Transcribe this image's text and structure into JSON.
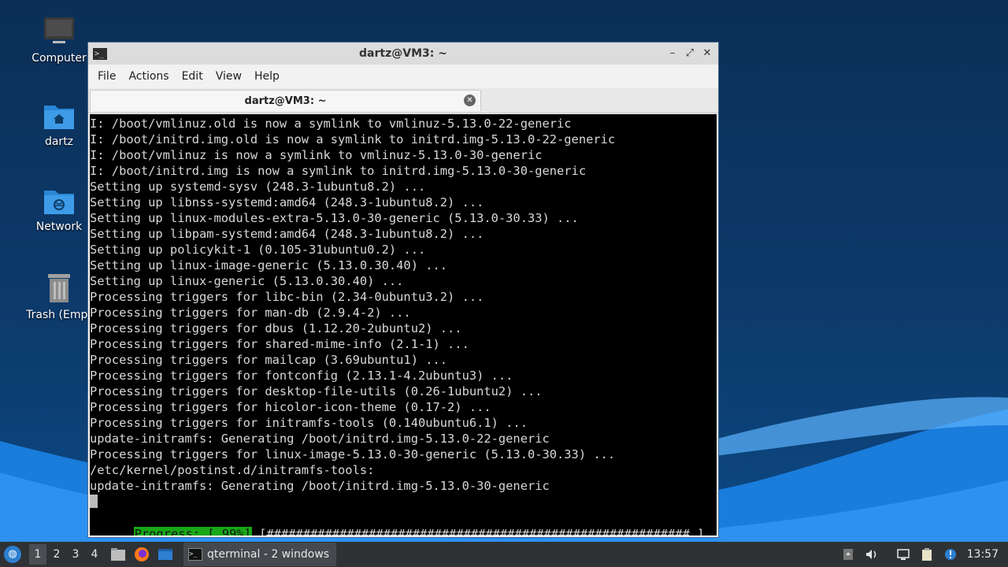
{
  "desktop": {
    "icons": [
      {
        "label": "Computer"
      },
      {
        "label": "dartz"
      },
      {
        "label": "Network"
      },
      {
        "label": "Trash (Empt"
      }
    ]
  },
  "window": {
    "title": "dartz@VM3: ~",
    "icon_text": ">_",
    "buttons": {
      "minimize": "–",
      "maximize": "⤢",
      "close": "✕"
    },
    "menu": [
      "File",
      "Actions",
      "Edit",
      "View",
      "Help"
    ],
    "tab": {
      "label": "dartz@VM3: ~",
      "close": "✕"
    }
  },
  "terminal": {
    "lines": [
      "I: /boot/vmlinuz.old is now a symlink to vmlinuz-5.13.0-22-generic",
      "I: /boot/initrd.img.old is now a symlink to initrd.img-5.13.0-22-generic",
      "I: /boot/vmlinuz is now a symlink to vmlinuz-5.13.0-30-generic",
      "I: /boot/initrd.img is now a symlink to initrd.img-5.13.0-30-generic",
      "Setting up systemd-sysv (248.3-1ubuntu8.2) ...",
      "Setting up libnss-systemd:amd64 (248.3-1ubuntu8.2) ...",
      "Setting up linux-modules-extra-5.13.0-30-generic (5.13.0-30.33) ...",
      "Setting up libpam-systemd:amd64 (248.3-1ubuntu8.2) ...",
      "Setting up policykit-1 (0.105-31ubuntu0.2) ...",
      "Setting up linux-image-generic (5.13.0.30.40) ...",
      "Setting up linux-generic (5.13.0.30.40) ...",
      "Processing triggers for libc-bin (2.34-0ubuntu3.2) ...",
      "Processing triggers for man-db (2.9.4-2) ...",
      "Processing triggers for dbus (1.12.20-2ubuntu2) ...",
      "Processing triggers for shared-mime-info (2.1-1) ...",
      "Processing triggers for mailcap (3.69ubuntu1) ...",
      "Processing triggers for fontconfig (2.13.1-4.2ubuntu3) ...",
      "Processing triggers for desktop-file-utils (0.26-1ubuntu2) ...",
      "Processing triggers for hicolor-icon-theme (0.17-2) ...",
      "Processing triggers for initramfs-tools (0.140ubuntu6.1) ...",
      "update-initramfs: Generating /boot/initrd.img-5.13.0-22-generic",
      "Processing triggers for linux-image-5.13.0-30-generic (5.13.0-30.33) ...",
      "/etc/kernel/postinst.d/initramfs-tools:",
      "update-initramfs: Generating /boot/initrd.img-5.13.0-30-generic"
    ],
    "progress_label": "Progress: [ 99%]",
    "progress_bar": " [##########################################################.]",
    "progress_percent": 99
  },
  "taskbar": {
    "start_icon": "start-menu-icon",
    "workspaces": [
      "1",
      "2",
      "3",
      "4"
    ],
    "active_workspace": "1",
    "task_label": "qterminal - 2 windows",
    "clock": "13:57"
  },
  "colors": {
    "desktop_bg": "#0c3a6b",
    "progress_green": "#18a818",
    "taskbar_bg": "#2f3235"
  }
}
